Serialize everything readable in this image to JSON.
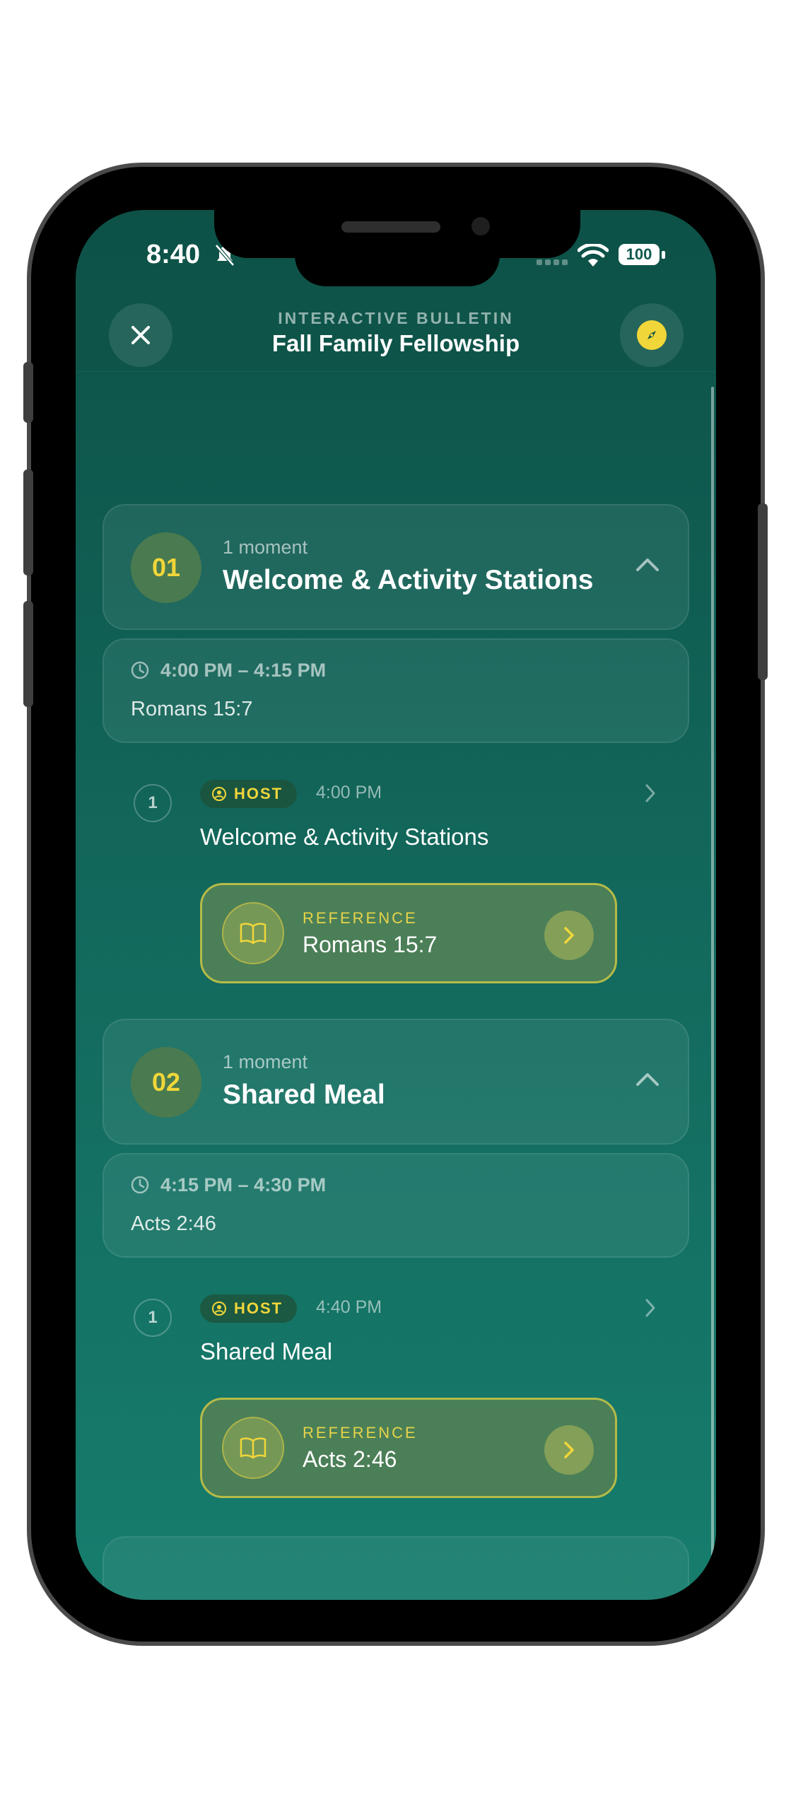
{
  "status_bar": {
    "time": "8:40",
    "battery": "100"
  },
  "header": {
    "kicker": "INTERACTIVE BULLETIN",
    "title": "Fall Family Fellowship"
  },
  "sections": [
    {
      "number": "01",
      "moments_count": "1 moment",
      "title": "Welcome & Activity Stations",
      "time_range": "4:00 PM – 4:15 PM",
      "scripture": "Romans 15:7",
      "moment": {
        "index": "1",
        "role": "HOST",
        "time": "4:00 PM",
        "title": "Welcome & Activity Stations",
        "reference_label": "REFERENCE",
        "reference": "Romans 15:7"
      }
    },
    {
      "number": "02",
      "moments_count": "1 moment",
      "title": "Shared Meal",
      "time_range": "4:15 PM – 4:30 PM",
      "scripture": "Acts 2:46",
      "moment": {
        "index": "1",
        "role": "HOST",
        "time": "4:40 PM",
        "title": "Shared Meal",
        "reference_label": "REFERENCE",
        "reference": "Acts 2:46"
      }
    }
  ],
  "colors": {
    "accent": "#f1d63a",
    "background": "#0d5147",
    "reference_card": "#4b7f57"
  }
}
